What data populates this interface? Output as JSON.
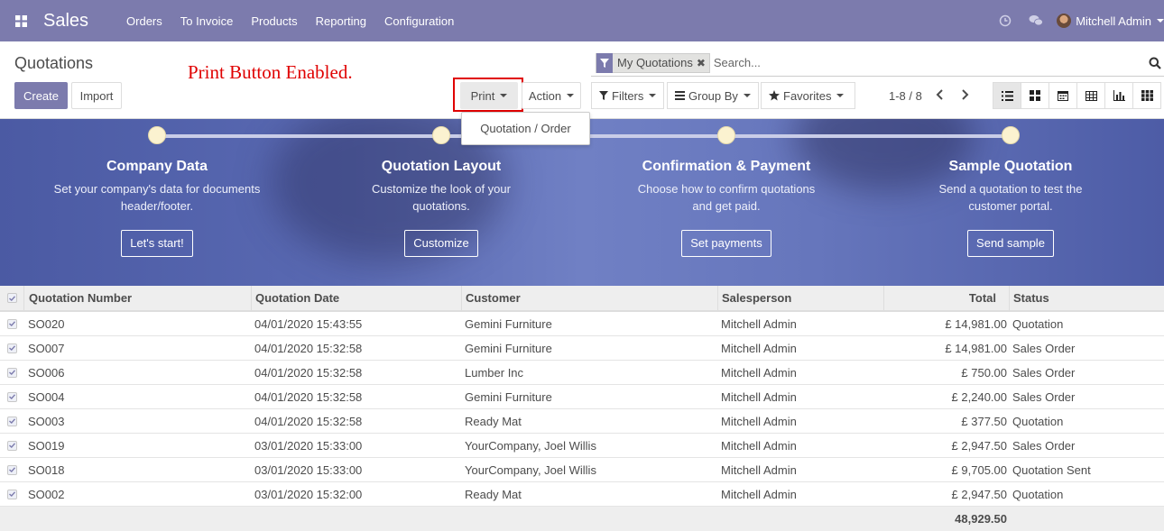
{
  "navbar": {
    "brand": "Sales",
    "menu": [
      "Orders",
      "To Invoice",
      "Products",
      "Reporting",
      "Configuration"
    ],
    "user": "Mitchell Admin"
  },
  "control": {
    "title": "Quotations",
    "create_label": "Create",
    "import_label": "Import",
    "annotation": "Print Button Enabled.",
    "print_label": "Print",
    "action_label": "Action",
    "print_menu_item": "Quotation / Order",
    "facet_label": "My Quotations",
    "search_placeholder": "Search...",
    "filters_label": "Filters",
    "groupby_label": "Group By",
    "favorites_label": "Favorites",
    "pager": "1-8 / 8"
  },
  "banner": {
    "steps": [
      {
        "title": "Company Data",
        "desc": "Set your company's data for documents header/footer.",
        "button": "Let's start!"
      },
      {
        "title": "Quotation Layout",
        "desc": "Customize the look of your quotations.",
        "button": "Customize"
      },
      {
        "title": "Confirmation & Payment",
        "desc": "Choose how to confirm quotations and get paid.",
        "button": "Set payments"
      },
      {
        "title": "Sample Quotation",
        "desc": "Send a quotation to test the customer portal.",
        "button": "Send sample"
      }
    ]
  },
  "table": {
    "headers": {
      "number": "Quotation Number",
      "date": "Quotation Date",
      "customer": "Customer",
      "salesperson": "Salesperson",
      "total": "Total",
      "status": "Status"
    },
    "rows": [
      {
        "number": "SO020",
        "date": "04/01/2020 15:43:55",
        "customer": "Gemini Furniture",
        "salesperson": "Mitchell Admin",
        "total": "£ 14,981.00",
        "status": "Quotation"
      },
      {
        "number": "SO007",
        "date": "04/01/2020 15:32:58",
        "customer": "Gemini Furniture",
        "salesperson": "Mitchell Admin",
        "total": "£ 14,981.00",
        "status": "Sales Order"
      },
      {
        "number": "SO006",
        "date": "04/01/2020 15:32:58",
        "customer": "Lumber Inc",
        "salesperson": "Mitchell Admin",
        "total": "£ 750.00",
        "status": "Sales Order"
      },
      {
        "number": "SO004",
        "date": "04/01/2020 15:32:58",
        "customer": "Gemini Furniture",
        "salesperson": "Mitchell Admin",
        "total": "£ 2,240.00",
        "status": "Sales Order"
      },
      {
        "number": "SO003",
        "date": "04/01/2020 15:32:58",
        "customer": "Ready Mat",
        "salesperson": "Mitchell Admin",
        "total": "£ 377.50",
        "status": "Quotation"
      },
      {
        "number": "SO019",
        "date": "03/01/2020 15:33:00",
        "customer": "YourCompany, Joel Willis",
        "salesperson": "Mitchell Admin",
        "total": "£ 2,947.50",
        "status": "Sales Order"
      },
      {
        "number": "SO018",
        "date": "03/01/2020 15:33:00",
        "customer": "YourCompany, Joel Willis",
        "salesperson": "Mitchell Admin",
        "total": "£ 9,705.00",
        "status": "Quotation Sent"
      },
      {
        "number": "SO002",
        "date": "03/01/2020 15:32:00",
        "customer": "Ready Mat",
        "salesperson": "Mitchell Admin",
        "total": "£ 2,947.50",
        "status": "Quotation"
      }
    ],
    "footer_total": "48,929.50"
  },
  "colors": {
    "brand": "#7c7bad",
    "annotation": "#e00000"
  },
  "icons": [
    "apps-icon",
    "clock-icon",
    "chat-icon",
    "filter-icon",
    "close-icon",
    "search-icon",
    "star-icon",
    "list-view-icon",
    "kanban-view-icon",
    "calendar-view-icon",
    "pivot-view-icon",
    "graph-view-icon",
    "grid-view-icon"
  ]
}
